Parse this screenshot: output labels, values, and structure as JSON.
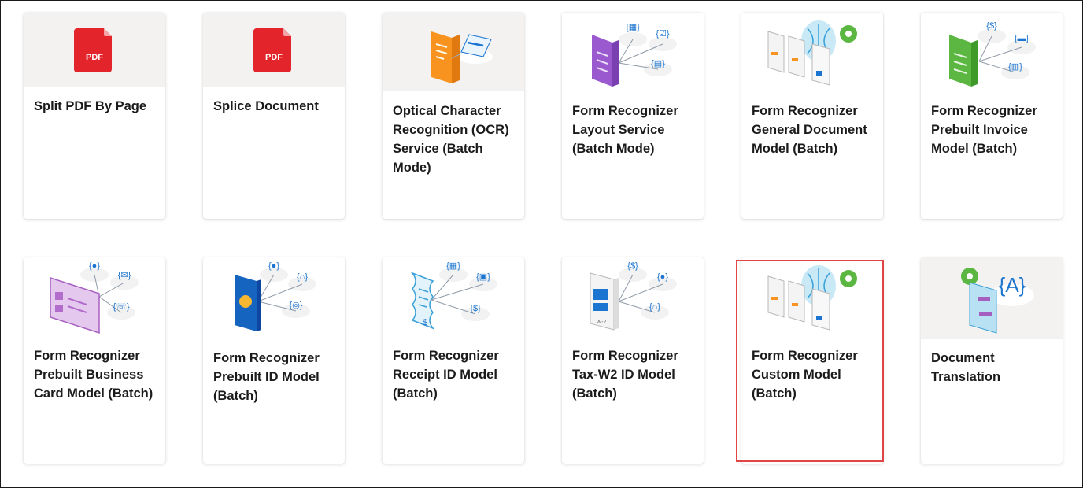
{
  "cards": [
    {
      "title": "Split PDF By Page",
      "icon": "pdf-icon",
      "badge": "PDF"
    },
    {
      "title": "Splice Document",
      "icon": "pdf-icon",
      "badge": "PDF"
    },
    {
      "title": "Optical Character Recognition (OCR) Service (Batch Mode)",
      "icon": "ocr-document-icon"
    },
    {
      "title": "Form Recognizer Layout Service (Batch Mode)",
      "icon": "layout-form-icon"
    },
    {
      "title": "Form Recognizer General Document Model (Batch)",
      "icon": "general-document-icon"
    },
    {
      "title": "Form Recognizer Prebuilt Invoice Model (Batch)",
      "icon": "invoice-icon"
    },
    {
      "title": "Form Recognizer Prebuilt Business Card Model (Batch)",
      "icon": "business-card-icon"
    },
    {
      "title": "Form Recognizer Prebuilt ID Model (Batch)",
      "icon": "passport-id-icon"
    },
    {
      "title": "Form Recognizer Receipt ID Model (Batch)",
      "icon": "receipt-icon"
    },
    {
      "title": "Form Recognizer Tax-W2 ID Model (Batch)",
      "icon": "tax-w2-icon",
      "badge": "W-2"
    },
    {
      "title": "Form Recognizer Custom Model (Batch)",
      "icon": "custom-model-icon"
    },
    {
      "title": "Document Translation",
      "icon": "translation-icon"
    }
  ],
  "highlight_color": "#e04646",
  "highlighted_card": "Form Recognizer Custom Model (Batch)"
}
